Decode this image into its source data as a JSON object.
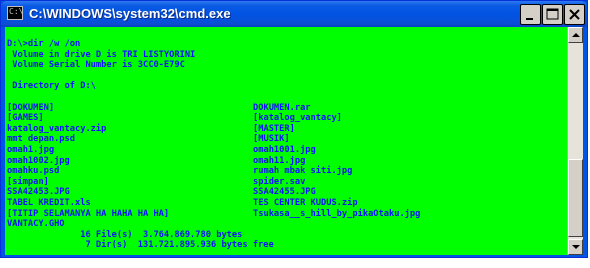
{
  "window": {
    "title": "C:\\WINDOWS\\system32\\cmd.exe",
    "icon_label": "C:\\",
    "colors": {
      "console_bg": "#00ff00",
      "console_text": "#1010ff",
      "titlebar": "#0054e3"
    }
  },
  "console": {
    "header_lines": [
      "D:\\>dir /w /on",
      " Volume in drive D is TRI LISTYORINI",
      " Volume Serial Number is 3CC0-E79C",
      "",
      " Directory of D:\\",
      ""
    ],
    "entries": [
      [
        "[DOKUMEN]",
        "DOKUMEN.rar"
      ],
      [
        "[GAMES]",
        "[katalog_vantacy]"
      ],
      [
        "katalog_vantacy.zip",
        "[MASTER]"
      ],
      [
        "mmt depan.psd",
        "[MUSIK]"
      ],
      [
        "omah1.jpg",
        "omah1001.jpg"
      ],
      [
        "omah1002.jpg",
        "omah11.jpg"
      ],
      [
        "omahku.psd",
        "rumah mbak siti.jpg"
      ],
      [
        "[simpan]",
        "spider.sav"
      ],
      [
        "SSA42453.JPG",
        "SSA42455.JPG"
      ],
      [
        "TABEL KREDIT.xls",
        "TES CENTER KUDUS.zip"
      ],
      [
        "[TITIP SELAMANYA HA HAHA HA HA]",
        "Tsukasa__s_hill_by_pikaOtaku.jpg"
      ],
      [
        "VANTACY.GHO",
        ""
      ]
    ],
    "summary": [
      "              16 File(s)  3.764.869.780 bytes",
      "               7 Dir(s)  131.721.895.936 bytes free"
    ]
  },
  "icons": {
    "minimize": "minimize-icon",
    "maximize": "maximize-icon",
    "close": "close-icon",
    "scroll_up": "arrow-up-icon",
    "scroll_down": "arrow-down-icon"
  }
}
